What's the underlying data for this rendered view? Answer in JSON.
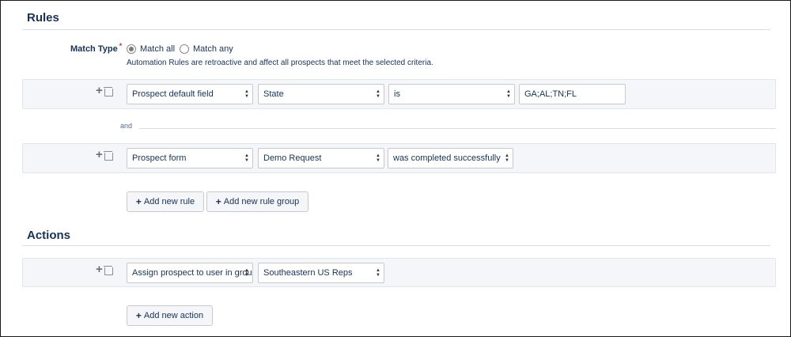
{
  "rules": {
    "title": "Rules",
    "match_type_label": "Match Type",
    "required_mark": "*",
    "match_all_label": "Match all",
    "match_any_label": "Match any",
    "selected": "Match all",
    "help_text": "Automation Rules are retroactive and affect all prospects that meet the selected criteria.",
    "row1": {
      "field_type": "Prospect default field",
      "field": "State",
      "operator": "is",
      "value": "GA;AL;TN;FL"
    },
    "connector": "and",
    "row2": {
      "field_type": "Prospect form",
      "field": "Demo Request",
      "operator": "was completed successfully"
    },
    "add_rule_label": "Add new rule",
    "add_rule_group_label": "Add new rule group"
  },
  "actions": {
    "title": "Actions",
    "row1": {
      "action": "Assign prospect to user in group",
      "target": "Southeastern US Reps"
    },
    "add_action_label": "Add new action"
  },
  "icons": {
    "plus": "plus-icon",
    "trash": "trash-icon",
    "select_caret": "updown-caret-icon",
    "radio": "radio-icon"
  }
}
